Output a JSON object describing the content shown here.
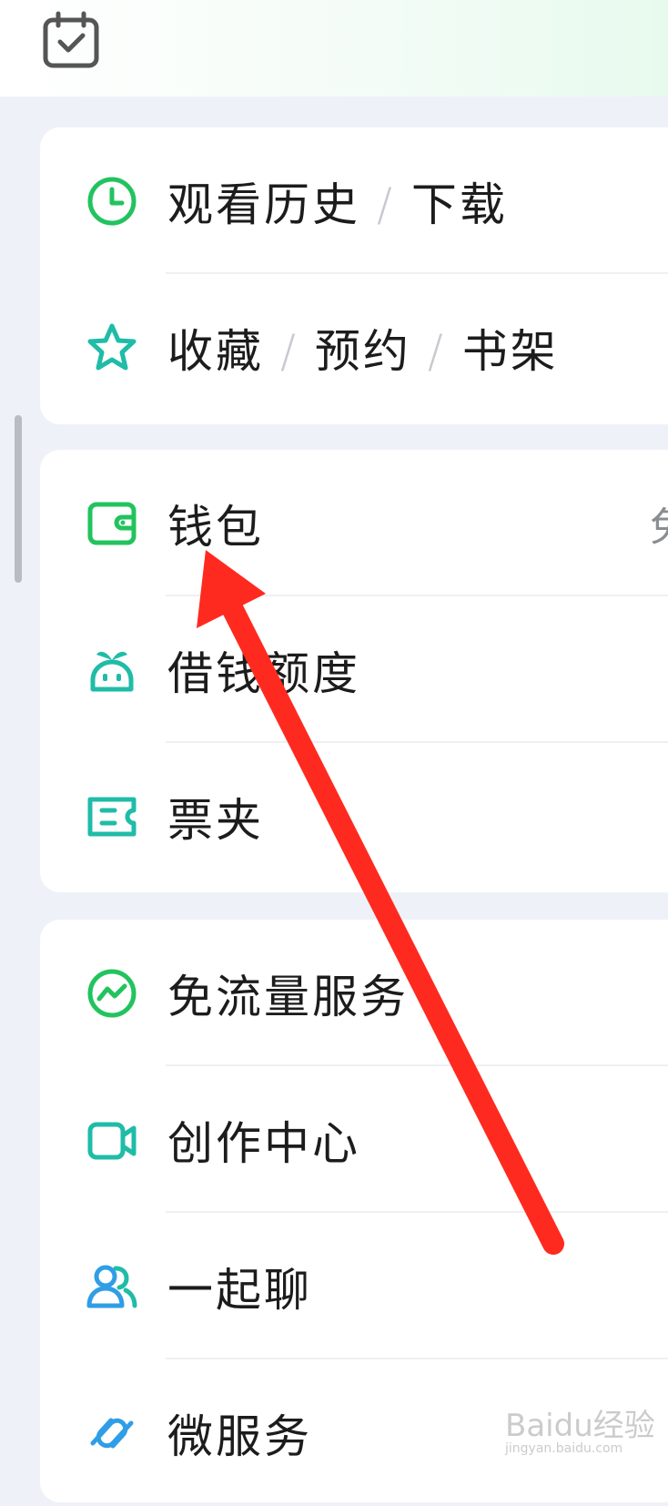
{
  "colors": {
    "green": "#22c35e",
    "teal": "#1fbca8",
    "blue": "#2f9ee6",
    "arrow": "#ff2a1f"
  },
  "top": {
    "icon": "calendar-check-icon"
  },
  "group1": {
    "history": {
      "icon": "clock-icon",
      "label_a": "观看历史",
      "sep": "/",
      "label_b": "下载"
    },
    "favorites": {
      "icon": "star-icon",
      "label_a": "收藏",
      "sep1": "/",
      "label_b": "预约",
      "sep2": "/",
      "label_c": "书架"
    }
  },
  "group2": {
    "wallet": {
      "icon": "wallet-icon",
      "label": "钱包",
      "hint": "免"
    },
    "loan": {
      "icon": "sprout-robot-icon",
      "label": "借钱额度"
    },
    "tickets": {
      "icon": "ticket-icon",
      "label": "票夹"
    }
  },
  "group3": {
    "data_free": {
      "icon": "trend-circle-icon",
      "label": "免流量服务"
    },
    "creator": {
      "icon": "video-camera-icon",
      "label": "创作中心"
    },
    "chat": {
      "icon": "people-icon",
      "label": "一起聊"
    },
    "micro": {
      "icon": "link-icon",
      "label": "微服务"
    }
  },
  "annotation": {
    "icon": "red-arrow-annotation"
  },
  "watermark": {
    "main": "Baidu经验",
    "sub": "jingyan.baidu.com"
  }
}
